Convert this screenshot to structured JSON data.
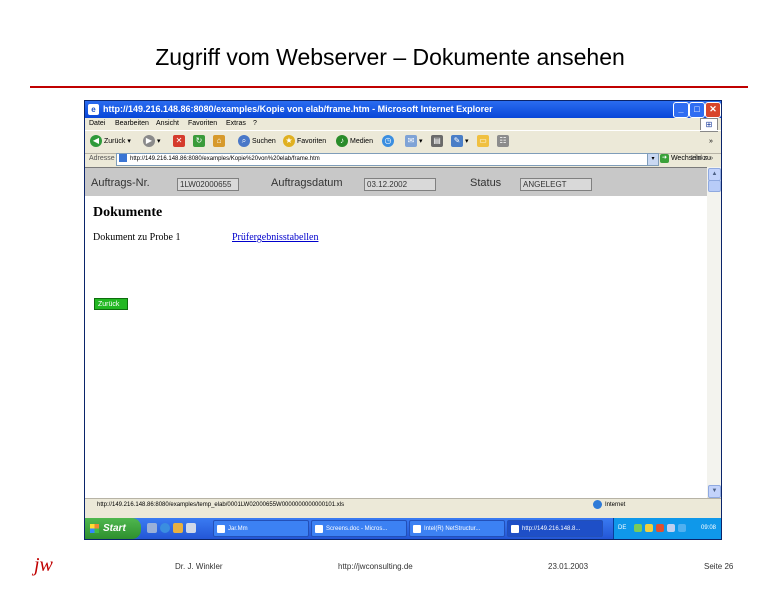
{
  "slide": {
    "title": "Zugriff vom Webserver – Dokumente ansehen"
  },
  "window": {
    "title": "http://149.216.148.86:8080/examples/Kopie von elab/frame.htm - Microsoft Internet Explorer"
  },
  "menu": [
    "Datei",
    "Bearbeiten",
    "Ansicht",
    "Favoriten",
    "Extras",
    "?"
  ],
  "toolbar": {
    "back": "Zurück",
    "search": "Suchen",
    "favorites": "Favoriten",
    "media": "Medien"
  },
  "address": {
    "label": "Adresse",
    "url": "http://149.216.148.86:8080/examples/Kopie%20von%20elab/frame.htm",
    "go": "Wechseln zu",
    "links": "Links"
  },
  "header": {
    "order_label": "Auftrags-Nr.",
    "order_value": "1LW02000655",
    "date_label": "Auftragsdatum",
    "date_value": "03.12.2002",
    "status_label": "Status",
    "status_value": "ANGELEGT"
  },
  "content": {
    "heading": "Dokumente",
    "document_name": "Dokument zu Probe 1",
    "document_link": "Prüfergebnisstabellen",
    "back_button": "Zurück"
  },
  "statusbar": {
    "url": "http://149.216.148.86:8080/examples/temp_elab/0001LW02000655W0000000000000101.xls",
    "zone": "Internet"
  },
  "taskbar": {
    "start": "Start",
    "tasks": [
      "Jar.Mm",
      "Screens.doc - Micros...",
      "Intel(R) NetStructur...",
      "http://149.216.148.8..."
    ],
    "language": "DE",
    "clock": "09:08"
  },
  "footer": {
    "logo": "jw",
    "author": "Dr. J. Winkler",
    "website": "http://jwconsulting.de",
    "date": "23.01.2003",
    "page": "Seite 26"
  },
  "colors": {
    "accent": "#c00000",
    "xp_titlebar": "#0846d8",
    "start_button": "#2e8f2e",
    "back_button": "#22b822",
    "link": "#0000cc"
  }
}
